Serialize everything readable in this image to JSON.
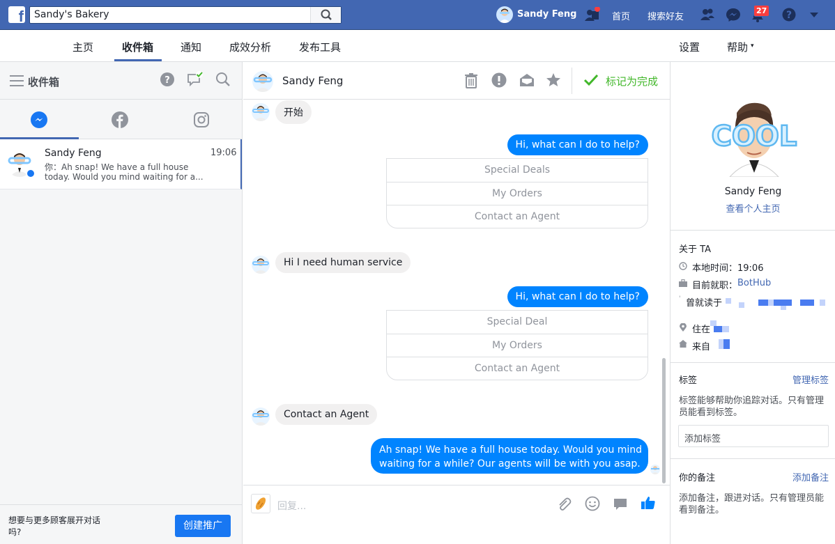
{
  "topbar": {
    "page_name": "Sandy's Bakery",
    "user_name": "Sandy Feng",
    "home": "首页",
    "find_friends": "搜索好友",
    "notification_count": "27"
  },
  "subnav": {
    "tabs": [
      "主页",
      "收件箱",
      "通知",
      "成效分析",
      "发布工具"
    ],
    "settings": "设置",
    "help": "帮助"
  },
  "inbox": {
    "title": "收件箱",
    "conversation": {
      "name": "Sandy Feng",
      "time": "19:06",
      "preview_line1": "你：Ah snap! We have a full house",
      "preview_line2": "today. Would you mind waiting for a..."
    },
    "promo_text_1": "想要与更多顾客展开对话",
    "promo_text_2": "吗?",
    "promo_button": "创建推广"
  },
  "chat": {
    "name": "Sandy Feng",
    "mark_done": "标记为完成",
    "msg_start": "开始",
    "msg_bot_1": "Hi, what can I do to help?",
    "qr_1": [
      "Special Deals",
      "My Orders",
      "Contact an Agent"
    ],
    "msg_human": "Hi I need human service",
    "msg_bot_2": "Hi, what can I do to help?",
    "qr_2": [
      "Special Deal",
      "My Orders",
      "Contact an Agent"
    ],
    "msg_contact": "Contact an Agent",
    "msg_final_1": "Ah snap! We have a full house today. Would you mind",
    "msg_final_2": "waiting for a while? Our agents will be with you asap.",
    "reply_placeholder": "回复..."
  },
  "profile": {
    "name": "Sandy Feng",
    "view_profile": "查看个人主页",
    "about_title": "关于 TA",
    "local_time": "本地时间：19:06",
    "work_prefix": "目前就职：",
    "work_company": "BotHub",
    "studied": "曾就读于",
    "lives": "住在",
    "from": "来自",
    "tags_title": "标签",
    "manage_tags": "管理标签",
    "tags_desc_1": "标签能够帮助你追踪对话。只有管理",
    "tags_desc_2": "员能看到标签。",
    "add_tag_placeholder": "添加标签",
    "notes_title": "你的备注",
    "add_note": "添加备注",
    "notes_desc_1": "添加备注，跟进对话。只有管理员能",
    "notes_desc_2": "看到备注。"
  },
  "colors": {
    "brand": "#4267b2",
    "messenger_blue": "#0084ff",
    "done_green": "#42b72a",
    "badge_red": "#fa3e3e"
  }
}
